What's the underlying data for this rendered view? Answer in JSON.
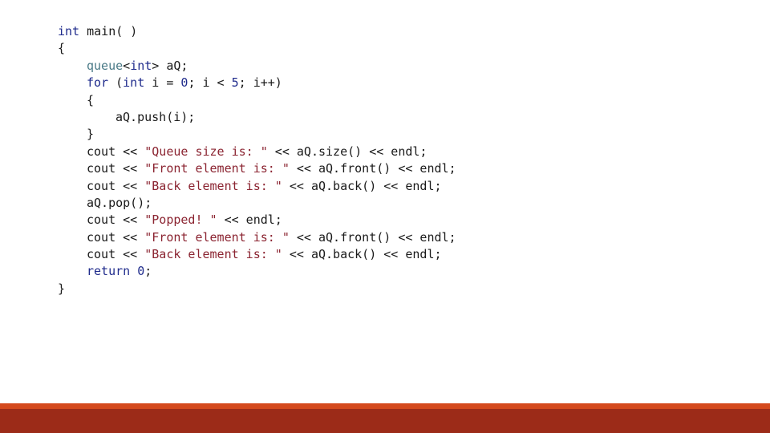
{
  "slide": {
    "background_color": "#ffffff",
    "title": "",
    "language": "cpp"
  },
  "code": {
    "font_family_hint": "monospace",
    "colors": {
      "keyword": "#1f2b8c",
      "type": "#4a7a87",
      "string": "#8b2431",
      "number": "#1f2b8c",
      "plain": "#1a1a1a"
    },
    "lines": [
      {
        "indent": 0,
        "text": "int main( )"
      },
      {
        "indent": 0,
        "text": "{"
      },
      {
        "indent": 1,
        "text": "queue<int> aQ;"
      },
      {
        "indent": 1,
        "text": "for (int i = 0; i < 5; i++)"
      },
      {
        "indent": 1,
        "text": "{"
      },
      {
        "indent": 2,
        "text": "aQ.push(i);"
      },
      {
        "indent": 1,
        "text": "}"
      },
      {
        "indent": 1,
        "text": "cout << \"Queue size is: \" << aQ.size() << endl;"
      },
      {
        "indent": 1,
        "text": "cout << \"Front element is: \" << aQ.front() << endl;"
      },
      {
        "indent": 1,
        "text": "cout << \"Back element is: \" << aQ.back() << endl;"
      },
      {
        "indent": 1,
        "text": "aQ.pop();"
      },
      {
        "indent": 1,
        "text": "cout << \"Popped! \" << endl;"
      },
      {
        "indent": 1,
        "text": "cout << \"Front element is: \" << aQ.front() << endl;"
      },
      {
        "indent": 1,
        "text": "cout << \"Back element is: \" << aQ.back() << endl;"
      },
      {
        "indent": 1,
        "text": "return 0;"
      },
      {
        "indent": 0,
        "text": "}"
      }
    ],
    "tokens": {
      "l0_kw": "int",
      "l0_rest": " main( )",
      "l1_brace": "{",
      "l2_type": "queue",
      "l2_lt": "<",
      "l2_kw": "int",
      "l2_rest": "> aQ;",
      "l3_kw_for": "for",
      "l3_paren": " (",
      "l3_kw_int": "int",
      "l3_mid": " i = ",
      "l3_zero": "0",
      "l3_semi": "; i < ",
      "l3_five": "5",
      "l3_tail": "; i++)",
      "l4_brace": "{",
      "l5_push": "aQ.push(i);",
      "l6_brace": "}",
      "l7_pre": "cout << ",
      "l7_str": "\"Queue size is: \"",
      "l7_post": " << aQ.size() << endl;",
      "l8_pre": "cout << ",
      "l8_str": "\"Front element is: \"",
      "l8_post": " << aQ.front() << endl;",
      "l9_pre": "cout << ",
      "l9_str": "\"Back element is: \"",
      "l9_post": " << aQ.back() << endl;",
      "l10_pop": "aQ.pop();",
      "l11_pre": "cout << ",
      "l11_str": "\"Popped! \"",
      "l11_post": " << endl;",
      "l12_pre": "cout << ",
      "l12_str": "\"Front element is: \"",
      "l12_post": " << aQ.front() << endl;",
      "l13_pre": "cout << ",
      "l13_str": "\"Back element is: \"",
      "l13_post": " << aQ.back() << endl;",
      "l14_kw": "return",
      "l14_sp": " ",
      "l14_num": "0",
      "l14_semi": ";",
      "l15_brace": "}"
    }
  },
  "footer": {
    "stripe_color": "#d4491d",
    "bar_color": "#9c2b18",
    "text": ""
  }
}
